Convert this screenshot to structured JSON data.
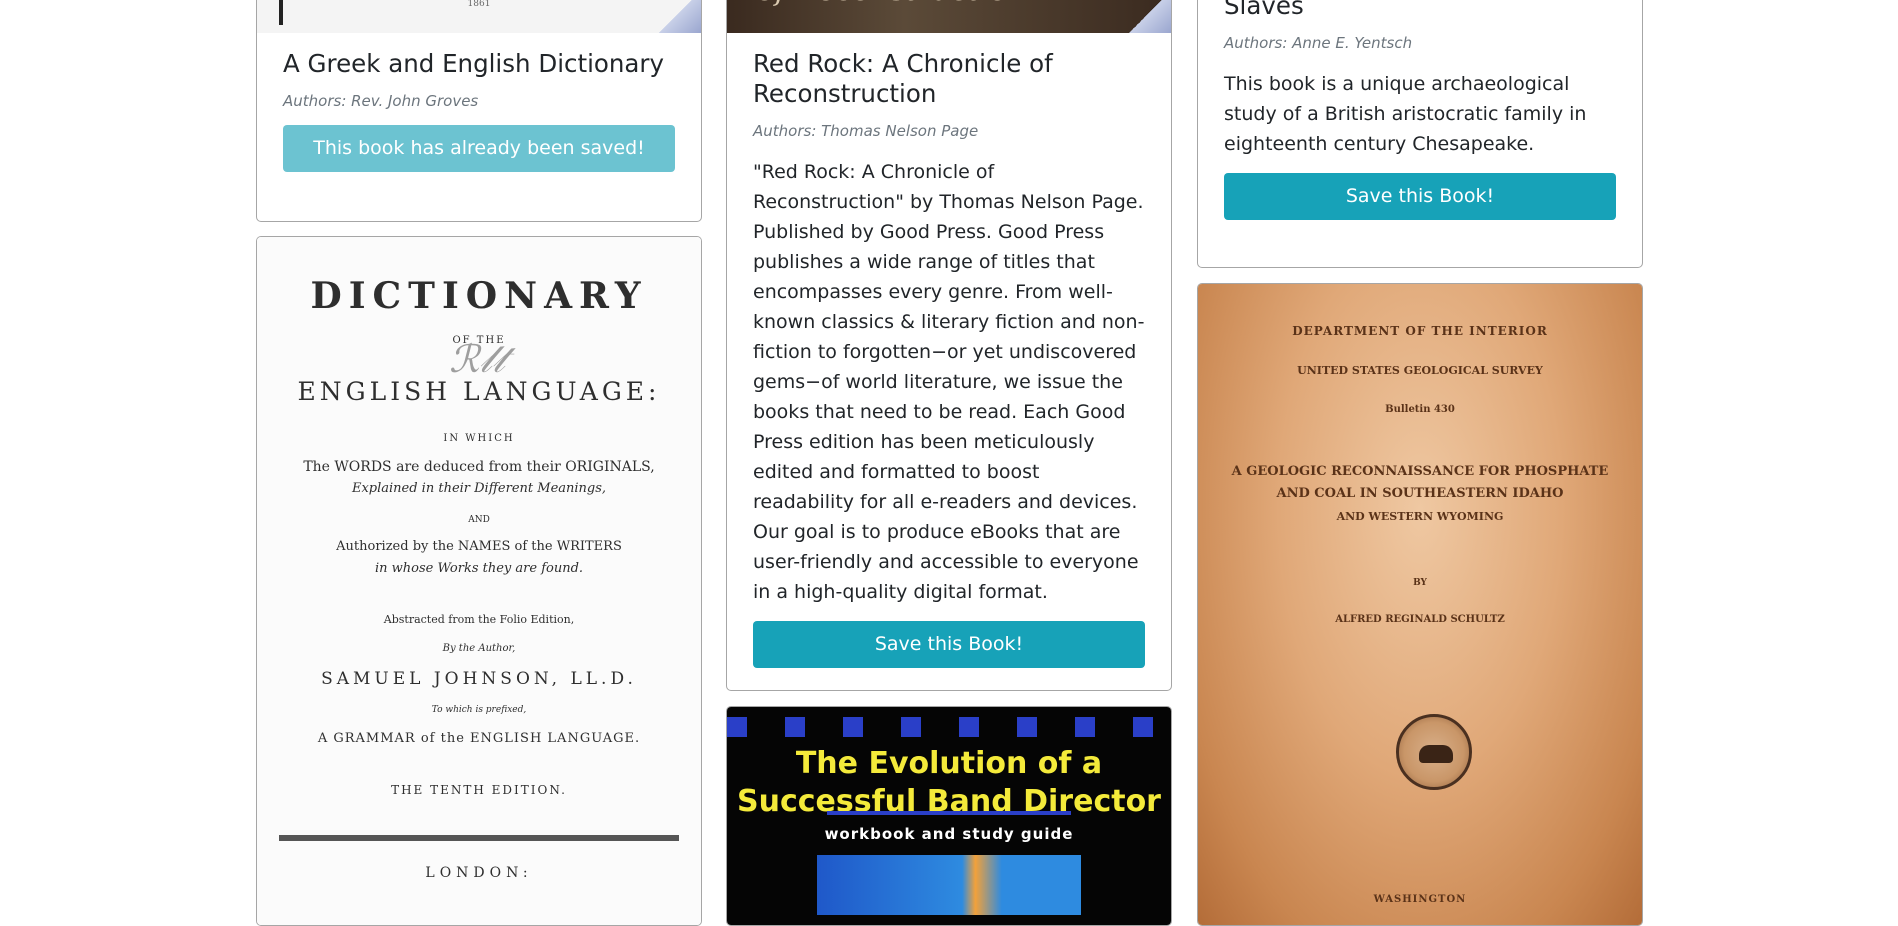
{
  "books": [
    {
      "title": "A Greek and English Dictionary",
      "authors": "Authors: Rev. John Groves",
      "button": "This book has already been saved!"
    },
    {
      "title": "Red Rock: A Chronicle of Reconstruction",
      "authors": "Authors: Thomas Nelson Page",
      "description": "\"Red Rock: A Chronicle of Reconstruction\" by Thomas Nelson Page. Published by Good Press. Good Press publishes a wide range of titles that encompasses every genre. From well-known classics & literary fiction and non-fiction to forgotten−or yet undiscovered gems−of world literature, we issue the books that need to be read. Each Good Press edition has been meticulously edited and formatted to boost readability for all e-readers and devices. Our goal is to produce eBooks that are user-friendly and accessible to everyone in a high-quality digital format.",
      "button": "Save this Book!"
    },
    {
      "title": "Slaves",
      "authors": "Authors: Anne E. Yentsch",
      "description": "This book is a unique archaeological study of a British aristocratic family in eighteenth century Chesapeake.",
      "button": "Save this Book!"
    }
  ],
  "covers": {
    "greek_top": "1861",
    "red_rock": "of Reconstruction",
    "dictionary": {
      "line1": "DICTIONARY",
      "line2": "OF THE",
      "line3": "ENGLISH LANGUAGE:",
      "line4": "IN WHICH",
      "line5": "The WORDS are deduced from their ORIGINALS,",
      "line6": "Explained in their Different Meanings,",
      "line7": "AND",
      "line8": "Authorized by the NAMES of the WRITERS",
      "line9": "in whose Works they are found.",
      "line10": "Abstracted from the Folio Edition,",
      "line11": "By the Author,",
      "line12": "SAMUEL JOHNSON, LL.D.",
      "line13": "To which is prefixed,",
      "line14": "A GRAMMAR of the ENGLISH LANGUAGE.",
      "line15": "THE TENTH EDITION.",
      "line16": "LONDON:"
    },
    "band": {
      "title_line1": "The Evolution of a",
      "title_line2": "Successful Band Director",
      "subtitle": "workbook and study guide"
    },
    "geological": {
      "line1": "DEPARTMENT OF THE INTERIOR",
      "line2": "UNITED STATES GEOLOGICAL SURVEY",
      "line3": "Bulletin 430",
      "line4": "A GEOLOGIC RECONNAISSANCE FOR PHOSPHATE",
      "line5": "AND COAL IN SOUTHEASTERN IDAHO",
      "line6": "AND WESTERN WYOMING",
      "line7": "BY",
      "line8": "ALFRED REGINALD SCHULTZ",
      "line9": "WASHINGTON"
    }
  }
}
